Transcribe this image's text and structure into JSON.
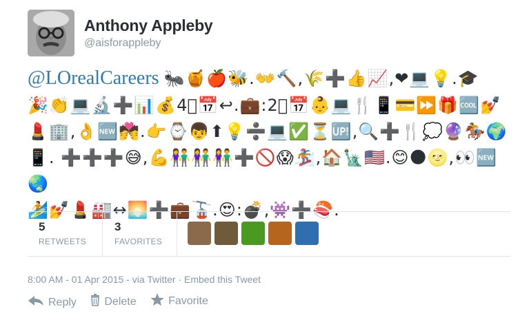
{
  "user": {
    "name": "Anthony Appleby",
    "handle": "@aisforappleby"
  },
  "tweet": {
    "mention": "@LOrealCareers",
    "emoji_lines": [
      "🐜🍯🍎🐝.👐🔨,🌾➕👍📈,❤💻💡.🎓",
      "🎉👏💻🔬➕📊💰4⃣📅↩.💼:2⃣📅👶💻🍴📱💳⏩🎁🆒💅",
      "💄🏢,👌🆕💏.👉⌚👦⬆💡➗💻✅⏳🆙,🔍➕🍴💭🔮🏇🌍",
      "📱. ➕➕➕😅,💪👫👫👫➕🚫😱🏂,🏠🗽🇺🇸.😊🌑🌝,👀🆕🌏",
      "🏄💅💄🏭↔🌅➕💼🚡.😍:💣,👾➕🍣."
    ]
  },
  "stats": {
    "retweets_count": "5",
    "retweets_label": "RETWEETS",
    "favorites_count": "3",
    "favorites_label": "FAVORITES"
  },
  "favoriters": [
    {
      "name": "avatar-1",
      "color": "#8a6a4a"
    },
    {
      "name": "avatar-2",
      "color": "#6f5b3c"
    },
    {
      "name": "avatar-3",
      "color": "#4a9a22"
    },
    {
      "name": "avatar-4",
      "color": "#b5651d"
    },
    {
      "name": "avatar-5",
      "color": "#2f6fb0"
    }
  ],
  "meta": {
    "timestamp": "8:00 AM - 01 Apr 2015",
    "via": "via Twitter",
    "embed": "Embed this Tweet",
    "sep1": " - ",
    "sep2": " · "
  },
  "actions": {
    "reply": "Reply",
    "delete": "Delete",
    "favorite": "Favorite",
    "reply_icon": "reply-arrow-icon",
    "delete_icon": "trash-icon",
    "favorite_icon": "star-icon"
  },
  "colors": {
    "mention": "#2b7bb9",
    "muted": "#8899a6",
    "divider": "#e1e8ed",
    "text": "#292f33"
  }
}
